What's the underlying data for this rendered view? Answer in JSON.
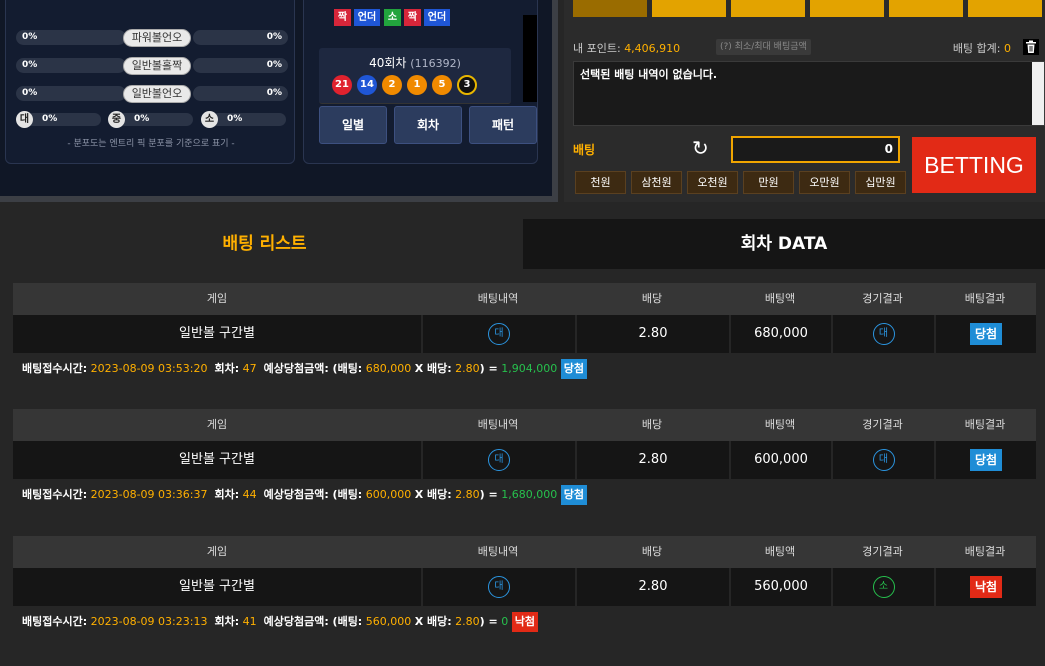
{
  "stats": {
    "rows": [
      {
        "left_pct": "0%",
        "label": "파워볼언오",
        "right_pct": "0%"
      },
      {
        "left_pct": "0%",
        "label": "일반볼홀짝",
        "right_pct": "0%"
      },
      {
        "left_pct": "0%",
        "label": "일반볼언오",
        "right_pct": "0%"
      }
    ],
    "size_row": [
      {
        "badge": "대",
        "pct": "0%"
      },
      {
        "badge": "중",
        "pct": "0%"
      },
      {
        "badge": "소",
        "pct": "0%"
      }
    ],
    "note": "- 분포도는 엔트리 픽 분포를 기준으로 표기 -"
  },
  "results": {
    "tags": [
      {
        "label": "짝",
        "color": "red"
      },
      {
        "label": "언더",
        "color": "blue"
      },
      {
        "label": "소",
        "color": "green"
      },
      {
        "label": "짝",
        "color": "red"
      },
      {
        "label": "언더",
        "color": "blue"
      }
    ],
    "round_label": "40회차",
    "round_id": "(116392)",
    "balls": [
      {
        "num": "21",
        "color": "#e0222e"
      },
      {
        "num": "14",
        "color": "#1f56d6"
      },
      {
        "num": "2",
        "color": "#f08a00"
      },
      {
        "num": "1",
        "color": "#f08a00"
      },
      {
        "num": "5",
        "color": "#f08a00"
      },
      {
        "num": "3",
        "color": "#111111"
      }
    ],
    "nav": [
      "일별",
      "회차",
      "패턴"
    ]
  },
  "betting": {
    "points_label": "내 포인트:",
    "points_value": "4,406,910",
    "minmax_label": "(?) 최소/최대 배팅금액",
    "sum_label": "배팅 합계:",
    "sum_value": "0",
    "empty_msg": "선택된 배팅 내역이 없습니다.",
    "bet_label": "배팅",
    "amount": "0",
    "betting_button": "BETTING",
    "amounts": [
      "천원",
      "삼천원",
      "오천원",
      "만원",
      "오만원",
      "십만원"
    ]
  },
  "tabs": {
    "bet_list": "배팅 리스트",
    "round_data": "회차 DATA"
  },
  "columns": [
    "게임",
    "배팅내역",
    "배당",
    "배팅액",
    "경기결과",
    "배팅결과"
  ],
  "bets": [
    {
      "game": "일반볼 구간별",
      "pick": "대",
      "odds": "2.80",
      "amount": "680,000",
      "outcome": "대",
      "outcome_color": "blue",
      "result": "당첨",
      "result_type": "win",
      "info_time_label": "배팅접수시간:",
      "info_time": "2023-08-09 03:53:20",
      "info_round_label": "회차:",
      "info_round": "47",
      "info_expect_label": "예상당첨금액: (배팅:",
      "info_bet": "680,000",
      "info_x": "X 배당:",
      "info_odds": "2.80",
      "info_eq": ") =",
      "info_payout": "1,904,000"
    },
    {
      "game": "일반볼 구간별",
      "pick": "대",
      "odds": "2.80",
      "amount": "600,000",
      "outcome": "대",
      "outcome_color": "blue",
      "result": "당첨",
      "result_type": "win",
      "info_time_label": "배팅접수시간:",
      "info_time": "2023-08-09 03:36:37",
      "info_round_label": "회차:",
      "info_round": "44",
      "info_expect_label": "예상당첨금액: (배팅:",
      "info_bet": "600,000",
      "info_x": "X 배당:",
      "info_odds": "2.80",
      "info_eq": ") =",
      "info_payout": "1,680,000"
    },
    {
      "game": "일반볼 구간별",
      "pick": "대",
      "odds": "2.80",
      "amount": "560,000",
      "outcome": "소",
      "outcome_color": "green",
      "result": "낙첨",
      "result_type": "lose",
      "info_time_label": "배팅접수시간:",
      "info_time": "2023-08-09 03:23:13",
      "info_round_label": "회차:",
      "info_round": "41",
      "info_expect_label": "예상당첨금액: (배팅:",
      "info_bet": "560,000",
      "info_x": "X 배당:",
      "info_odds": "2.80",
      "info_eq": ") =",
      "info_payout": "0"
    }
  ]
}
